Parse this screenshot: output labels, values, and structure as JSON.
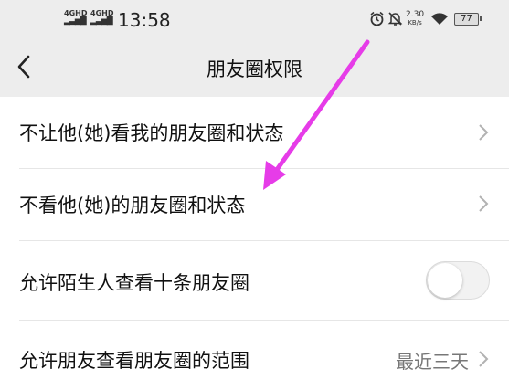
{
  "status_bar": {
    "network_1": "4GHD",
    "network_2": "4GHD",
    "time": "13:58",
    "speed_value": "2.30",
    "speed_unit": "KB/s",
    "battery": "77",
    "icons": [
      "alarm-icon",
      "notifications-off-icon",
      "wifi-icon",
      "battery-icon"
    ]
  },
  "nav": {
    "title": "朋友圈权限",
    "back_icon": "chevron-left-icon"
  },
  "settings": [
    {
      "label": "不让他(她)看我的朋友圈和状态",
      "control": "chevron"
    },
    {
      "label": "不看他(她)的朋友圈和状态",
      "control": "chevron"
    },
    {
      "label": "允许陌生人查看十条朋友圈",
      "control": "toggle",
      "toggle_on": false
    },
    {
      "label": "允许朋友查看朋友圈的范围",
      "control": "chevron",
      "value": "最近三天"
    }
  ],
  "colors": {
    "background": "#ededed",
    "list_background": "#ffffff",
    "annotation_arrow": "#e63ce8"
  }
}
